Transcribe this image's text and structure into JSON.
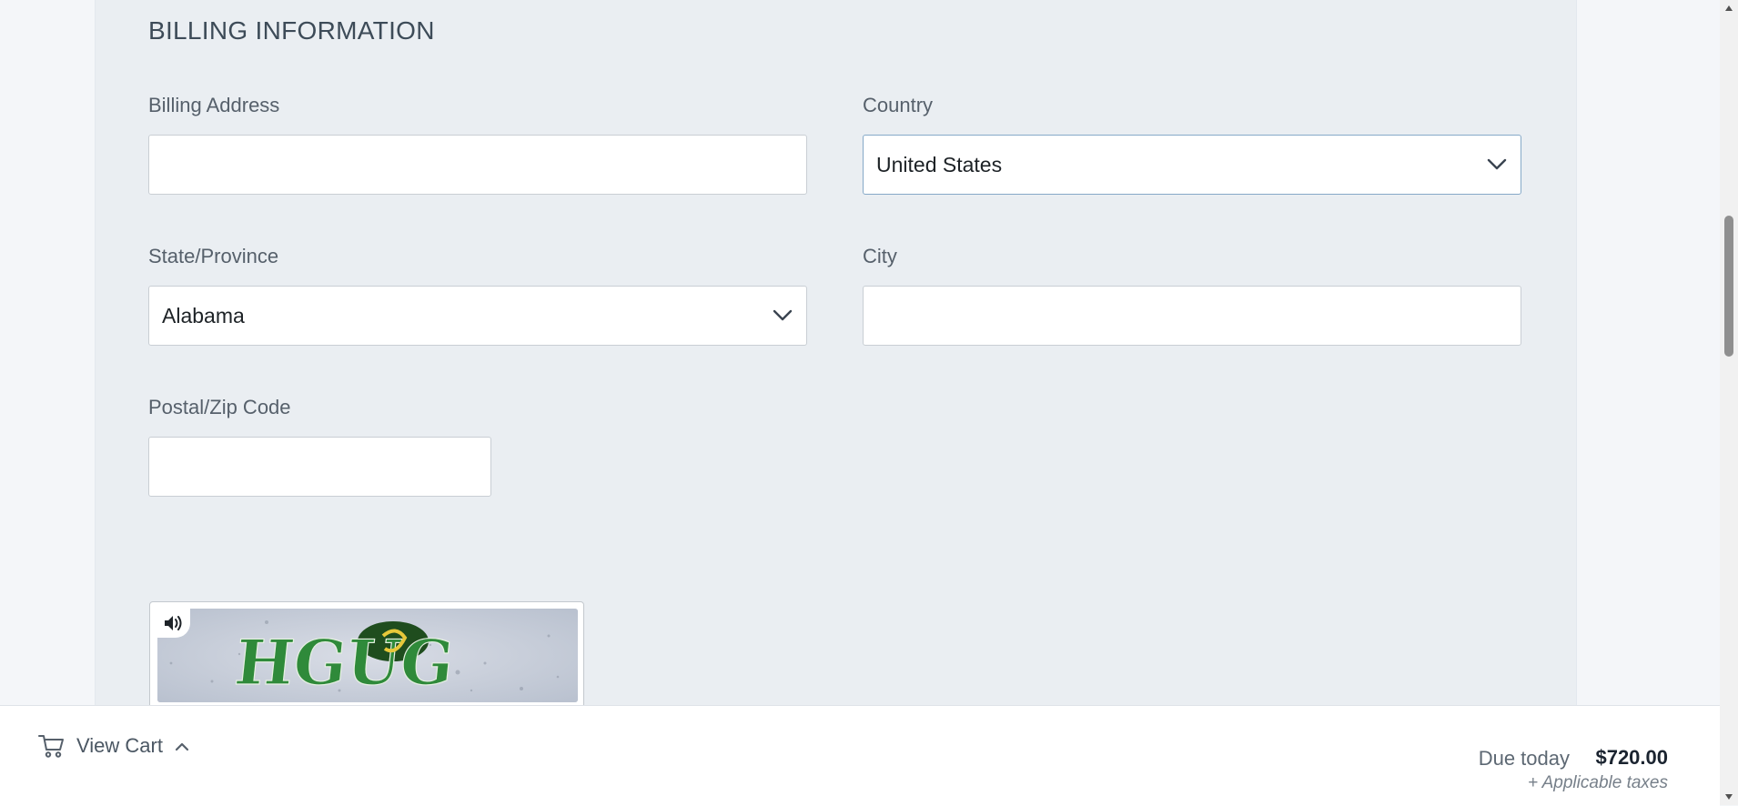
{
  "billing": {
    "section_title": "BILLING INFORMATION",
    "address": {
      "label": "Billing Address",
      "value": ""
    },
    "country": {
      "label": "Country",
      "selected": "United States"
    },
    "state": {
      "label": "State/Province",
      "selected": "Alabama"
    },
    "city": {
      "label": "City",
      "value": ""
    },
    "postal": {
      "label": "Postal/Zip Code",
      "value": ""
    }
  },
  "captcha": {
    "challenge_text": "HGUG"
  },
  "cart_bar": {
    "view_cart_label": "View Cart",
    "due_label": "Due today",
    "due_amount": "$720.00",
    "taxes_note": "+ Applicable taxes"
  },
  "colors": {
    "panel_bg": "#eaeef2",
    "page_bg": "#f4f6f9",
    "captcha_letters": "#2f8a3a"
  }
}
